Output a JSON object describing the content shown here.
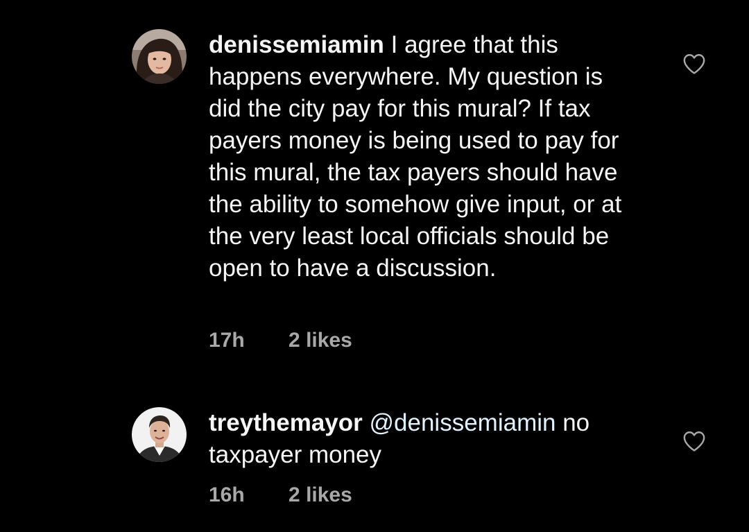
{
  "comments": [
    {
      "username": "denissemiamin",
      "mention": "",
      "text": "I agree that this happens everywhere. My question is did the city pay for this mural? If tax payers money is being used to pay for this mural,  the tax payers should have the ability to somehow give input, or at the very least local officials should be open to have a discussion.",
      "time": "17h",
      "likes": "2 likes",
      "avatar_icon": "profile-photo-woman",
      "like_icon": "heart-outline-icon"
    },
    {
      "username": "treythemayor",
      "mention": "@denissemiamin",
      "text": "no taxpayer money",
      "time": "16h",
      "likes": "2 likes",
      "avatar_icon": "profile-photo-man",
      "like_icon": "heart-outline-icon"
    }
  ],
  "colors": {
    "background": "#000000",
    "text": "#f5f5f5",
    "meta": "#a8a8a8",
    "mention": "#e0f1ff"
  }
}
